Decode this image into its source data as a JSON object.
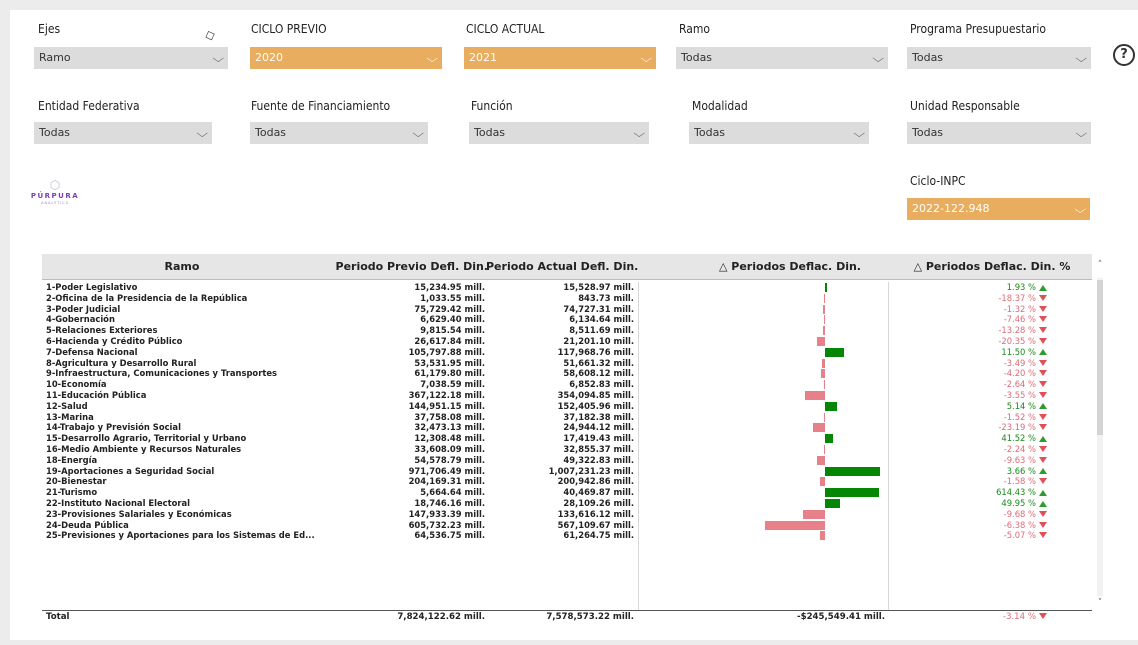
{
  "filters_row1": [
    {
      "label": "Ejes",
      "value": "Ramo",
      "highlight": false
    },
    {
      "label": "CICLO PREVIO",
      "value": "2020",
      "highlight": true
    },
    {
      "label": "CICLO ACTUAL",
      "value": "2021",
      "highlight": true
    },
    {
      "label": "Ramo",
      "value": "Todas",
      "highlight": false
    },
    {
      "label": "Programa Presupuestario",
      "value": "Todas",
      "highlight": false
    }
  ],
  "filters_row2": [
    {
      "label": "Entidad Federativa",
      "value": "Todas"
    },
    {
      "label": "Fuente de Financiamiento",
      "value": "Todas"
    },
    {
      "label": "Función",
      "value": "Todas"
    },
    {
      "label": "Modalidad",
      "value": "Todas"
    },
    {
      "label": "Unidad Responsable",
      "value": "Todas"
    }
  ],
  "inpc": {
    "label": "Ciclo-INPC",
    "value": "2022-122.948"
  },
  "help_symbol": "?",
  "logo": {
    "name": "PÚRPURA",
    "sub": "ANALYTICS"
  },
  "colors": {
    "highlight": "#e8ad5e",
    "positive_bar": "#058605",
    "negative_bar": "#e8808a",
    "up_arrow": "#2e9b2e",
    "down_arrow": "#e0505a"
  },
  "table": {
    "headers": [
      "Ramo",
      "Periodo Previo Defl. Din.",
      "Periodo Actual Defl. Din.",
      "△ Periodos Deflac. Din.",
      "△ Periodos Deflac. Din. %"
    ],
    "rows": [
      {
        "name": "1-Poder Legislativo",
        "prev": "15,234.95 mill.",
        "curr": "15,528.97 mill.",
        "pct": "1.93 %",
        "dir": "up",
        "delta_mill": 294.02
      },
      {
        "name": "2-Oficina de la Presidencia de la República",
        "prev": "1,033.55 mill.",
        "curr": "843.73 mill.",
        "pct": "-18.37 %",
        "dir": "down",
        "delta_mill": -189.82
      },
      {
        "name": "3-Poder Judicial",
        "prev": "75,729.42 mill.",
        "curr": "74,727.31 mill.",
        "pct": "-1.32 %",
        "dir": "down",
        "delta_mill": -1002.11
      },
      {
        "name": "4-Gobernación",
        "prev": "6,629.40 mill.",
        "curr": "6,134.64 mill.",
        "pct": "-7.46 %",
        "dir": "down",
        "delta_mill": -494.76
      },
      {
        "name": "5-Relaciones Exteriores",
        "prev": "9,815.54 mill.",
        "curr": "8,511.69 mill.",
        "pct": "-13.28 %",
        "dir": "down",
        "delta_mill": -1303.85
      },
      {
        "name": "6-Hacienda y Crédito Público",
        "prev": "26,617.84 mill.",
        "curr": "21,201.10 mill.",
        "pct": "-20.35 %",
        "dir": "down",
        "delta_mill": -5416.74
      },
      {
        "name": "7-Defensa Nacional",
        "prev": "105,797.88 mill.",
        "curr": "117,968.76 mill.",
        "pct": "11.50 %",
        "dir": "up",
        "delta_mill": 12170.88
      },
      {
        "name": "8-Agricultura y Desarrollo Rural",
        "prev": "53,531.95 mill.",
        "curr": "51,661.32 mill.",
        "pct": "-3.49 %",
        "dir": "down",
        "delta_mill": -1870.63
      },
      {
        "name": "9-Infraestructura, Comunicaciones y Transportes",
        "prev": "61,179.80 mill.",
        "curr": "58,608.12 mill.",
        "pct": "-4.20 %",
        "dir": "down",
        "delta_mill": -2571.68
      },
      {
        "name": "10-Economía",
        "prev": "7,038.59 mill.",
        "curr": "6,852.83 mill.",
        "pct": "-2.64 %",
        "dir": "down",
        "delta_mill": -185.76
      },
      {
        "name": "11-Educación Pública",
        "prev": "367,122.18 mill.",
        "curr": "354,094.85 mill.",
        "pct": "-3.55 %",
        "dir": "down",
        "delta_mill": -13027.33
      },
      {
        "name": "12-Salud",
        "prev": "144,951.15 mill.",
        "curr": "152,405.96 mill.",
        "pct": "5.14 %",
        "dir": "up",
        "delta_mill": 7454.81
      },
      {
        "name": "13-Marina",
        "prev": "37,758.08 mill.",
        "curr": "37,182.38 mill.",
        "pct": "-1.52 %",
        "dir": "down",
        "delta_mill": -575.7
      },
      {
        "name": "14-Trabajo y Previsión Social",
        "prev": "32,473.13 mill.",
        "curr": "24,944.12 mill.",
        "pct": "-23.19 %",
        "dir": "down",
        "delta_mill": -7529.01
      },
      {
        "name": "15-Desarrollo Agrario, Territorial y Urbano",
        "prev": "12,308.48 mill.",
        "curr": "17,419.43 mill.",
        "pct": "41.52 %",
        "dir": "up",
        "delta_mill": 5110.95
      },
      {
        "name": "16-Medio Ambiente y Recursos Naturales",
        "prev": "33,608.09 mill.",
        "curr": "32,855.37 mill.",
        "pct": "-2.24 %",
        "dir": "down",
        "delta_mill": -752.72
      },
      {
        "name": "18-Energía",
        "prev": "54,578.79 mill.",
        "curr": "49,322.83 mill.",
        "pct": "-9.63 %",
        "dir": "down",
        "delta_mill": -5255.96
      },
      {
        "name": "19-Aportaciones a Seguridad Social",
        "prev": "971,706.49 mill.",
        "curr": "1,007,231.23 mill.",
        "pct": "3.66 %",
        "dir": "up",
        "delta_mill": 35524.74
      },
      {
        "name": "20-Bienestar",
        "prev": "204,169.31 mill.",
        "curr": "200,942.86 mill.",
        "pct": "-1.58 %",
        "dir": "down",
        "delta_mill": -3226.45
      },
      {
        "name": "21-Turismo",
        "prev": "5,664.64 mill.",
        "curr": "40,469.87 mill.",
        "pct": "614.43 %",
        "dir": "up",
        "delta_mill": 34805.23
      },
      {
        "name": "22-Instituto Nacional Electoral",
        "prev": "18,746.16 mill.",
        "curr": "28,109.26 mill.",
        "pct": "49.95 %",
        "dir": "up",
        "delta_mill": 9363.1
      },
      {
        "name": "23-Provisiones Salariales y Económicas",
        "prev": "147,933.39 mill.",
        "curr": "133,616.12 mill.",
        "pct": "-9.68 %",
        "dir": "down",
        "delta_mill": -14317.27
      },
      {
        "name": "24-Deuda Pública",
        "prev": "605,732.23 mill.",
        "curr": "567,109.67 mill.",
        "pct": "-6.38 %",
        "dir": "down",
        "delta_mill": -38622.56
      },
      {
        "name": "25-Previsiones y Aportaciones para los Sistemas de Ed...",
        "prev": "64,536.75 mill.",
        "curr": "61,264.75 mill.",
        "pct": "-5.07 %",
        "dir": "down",
        "delta_mill": -3272.0
      }
    ],
    "total": {
      "label": "Total",
      "prev": "7,824,122.62 mill.",
      "curr": "7,578,573.22 mill.",
      "delta": "-$245,549.41 mill.",
      "pct": "-3.14 %",
      "dir": "down"
    }
  }
}
